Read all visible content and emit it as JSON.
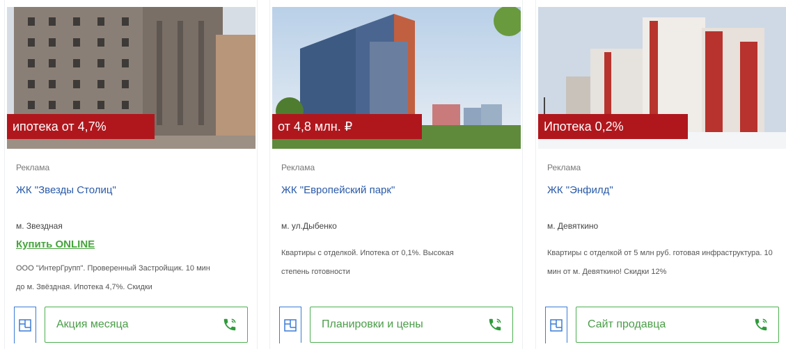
{
  "cards": [
    {
      "promo": "ипотека от 4,7%",
      "ad_label": "Реклама",
      "title": "ЖК \"Звезды Столиц\"",
      "metro": "м. Звездная",
      "buy_link": "Купить ONLINE",
      "description_lines": [
        "ООО \"ИнтерГрупп\". Проверенный Застройщик. 10 мин",
        "до м. Звёздная. Ипотека 4,7%. Скидки"
      ],
      "action_label": "Акция месяца",
      "icons": {
        "plan": "floor-plan-icon",
        "phone": "phone-icon"
      }
    },
    {
      "promo": "от 4,8 млн. ₽",
      "ad_label": "Реклама",
      "title": "ЖК \"Европейский парк\"",
      "metro": "м. ул.Дыбенко",
      "description_lines": [
        "Квартиры с отделкой. Ипотека от 0,1%. Высокая",
        "степень готовности"
      ],
      "action_label": "Планировки и цены",
      "icons": {
        "plan": "floor-plan-icon",
        "phone": "phone-icon"
      }
    },
    {
      "promo": "Ипотека 0,2%",
      "ad_label": "Реклама",
      "title": "ЖК \"Энфилд\"",
      "metro": "м. Девяткино",
      "description_lines": [
        "Квартиры с отделкой от 5 млн руб. готовая инфраструктура. 10",
        "мин от м. Девяткино! Скидки 12%"
      ],
      "action_label": "Сайт продавца",
      "icons": {
        "plan": "floor-plan-icon",
        "phone": "phone-icon"
      }
    }
  ],
  "colors": {
    "promo_bg": "#b0171d",
    "title": "#2a5aa8",
    "buy_link": "#46a43c",
    "action_border": "#4caf50",
    "plan_icon": "#3a7bd5"
  }
}
